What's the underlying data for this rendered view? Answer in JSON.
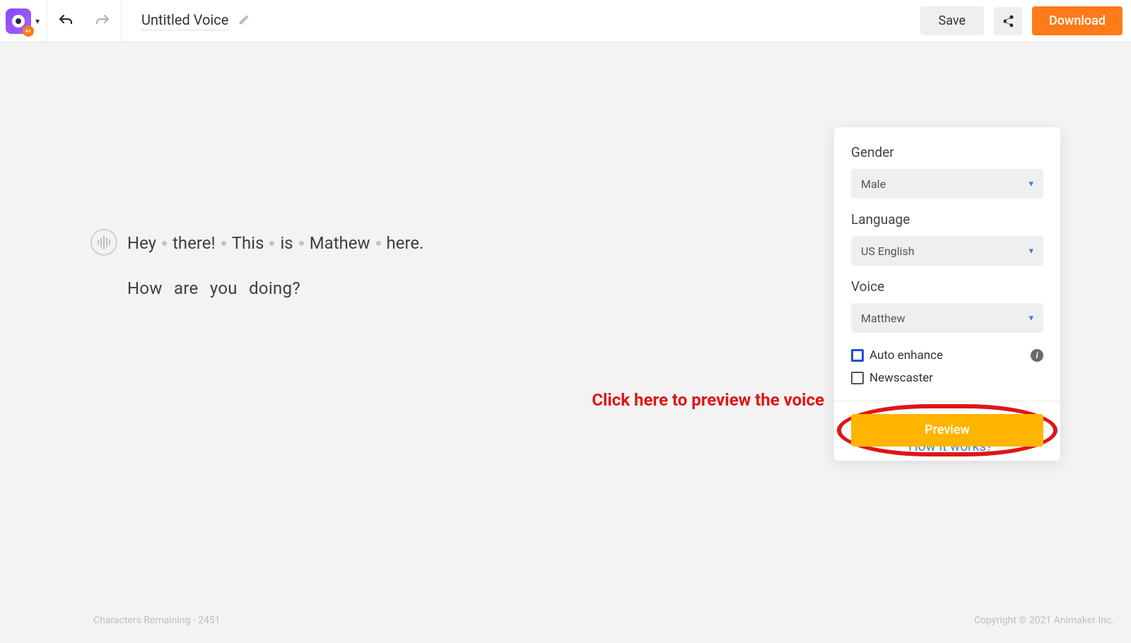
{
  "toolbar": {
    "title": "Untitled Voice",
    "save_label": "Save",
    "download_label": "Download"
  },
  "editor": {
    "line1_words": [
      "Hey",
      "there!",
      "This",
      "is",
      "Mathew",
      "here."
    ],
    "line2": "How  are  you  doing?"
  },
  "panel": {
    "gender_label": "Gender",
    "gender_value": "Male",
    "language_label": "Language",
    "language_value": "US English",
    "voice_label": "Voice",
    "voice_value": "Matthew",
    "auto_enhance_label": "Auto enhance",
    "newscaster_label": "Newscaster",
    "preview_label": "Preview"
  },
  "annotation": "Click here to preview the voice",
  "how_link": "How it works?",
  "footer": {
    "chars_remaining_label": "Characters Remaining - ",
    "chars_remaining_value": "2451",
    "copyright": "Copyright © 2021 Animaker Inc."
  }
}
